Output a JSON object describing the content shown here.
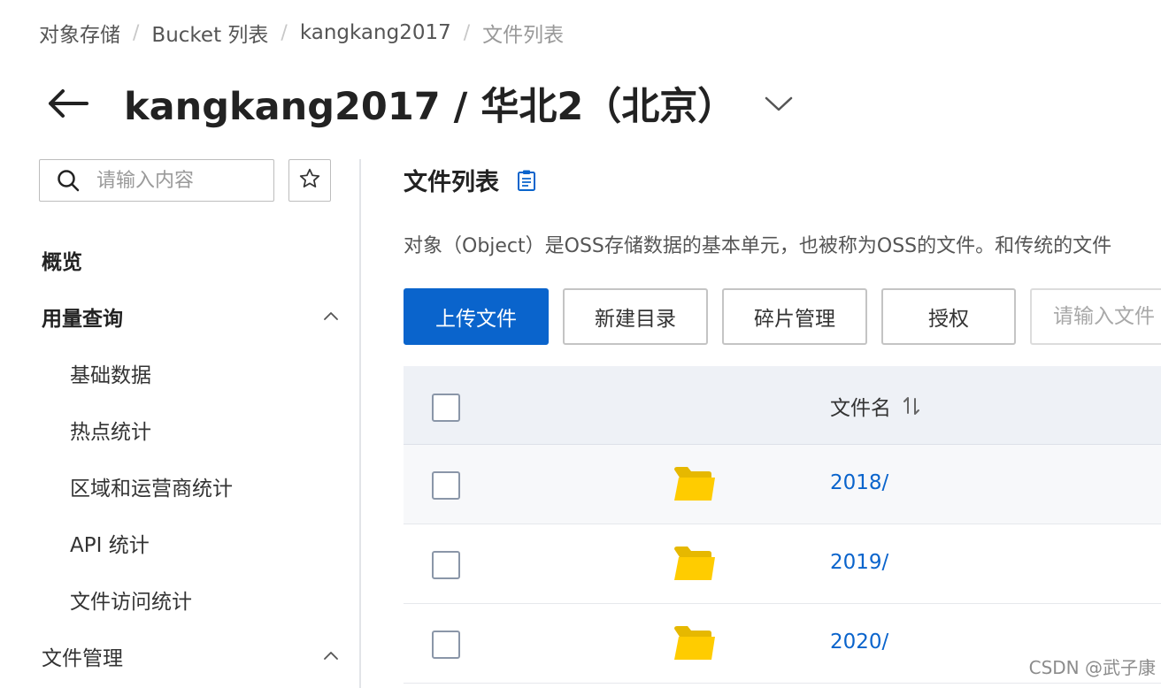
{
  "breadcrumb": {
    "items": [
      "对象存储",
      "Bucket 列表",
      "kangkang2017",
      "文件列表"
    ],
    "separator": "/"
  },
  "header": {
    "title": "kangkang2017 / 华北2（北京）"
  },
  "sidebar": {
    "search_placeholder": "请输入内容",
    "nav": [
      {
        "label": "概览"
      },
      {
        "label": "用量查询",
        "expanded": true
      },
      {
        "label": "基础数据"
      },
      {
        "label": "热点统计"
      },
      {
        "label": "区域和运营商统计"
      },
      {
        "label": "API 统计"
      },
      {
        "label": "文件访问统计"
      },
      {
        "label": "文件管理",
        "expanded": true
      }
    ]
  },
  "main": {
    "section_title": "文件列表",
    "description": "对象（Object）是OSS存储数据的基本单元，也被称为OSS的文件。和传统的文件",
    "toolbar": {
      "upload": "上传文件",
      "new_dir": "新建目录",
      "fragments": "碎片管理",
      "authorize": "授权",
      "search_placeholder": "请输入文件"
    },
    "table": {
      "col_name": "文件名",
      "rows": [
        {
          "name": "2018/",
          "type": "folder"
        },
        {
          "name": "2019/",
          "type": "folder"
        },
        {
          "name": "2020/",
          "type": "folder"
        }
      ]
    }
  },
  "colors": {
    "primary": "#0a64cc",
    "folder": "#ffcc00",
    "header_bg": "#eef1f6"
  },
  "watermark": "CSDN @武子康"
}
